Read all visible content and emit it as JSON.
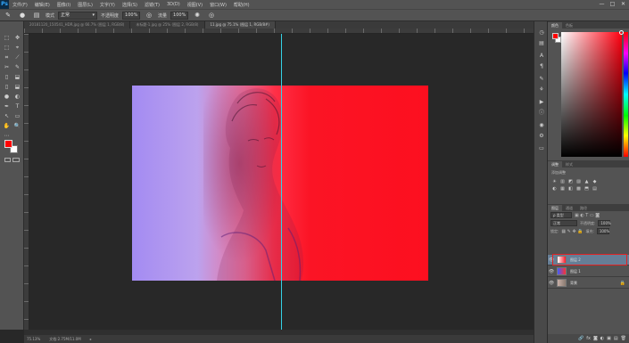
{
  "app": {
    "logo": "Ps",
    "menus": [
      "文件(F)",
      "编辑(E)",
      "图像(I)",
      "图层(L)",
      "文字(Y)",
      "选择(S)",
      "滤镜(T)",
      "3D(D)",
      "视图(V)",
      "窗口(W)",
      "帮助(H)"
    ],
    "window_controls": [
      "—",
      "□",
      "✕"
    ]
  },
  "options": {
    "mode_label": "模式",
    "mode_value": "正常",
    "opacity_label": "不透明度",
    "opacity_value": "100%",
    "flow_label": "流量",
    "flow_value": "100%"
  },
  "tabs": [
    {
      "label": "20181120_150541_HDR.jpg @ 66.7% (图层 1, RGB/8)",
      "active": false
    },
    {
      "label": "未标题-1.jpg @ 25% (图层 2, RGB/8)",
      "active": false
    },
    {
      "label": "11.jpg @ 75.1% (图层 1, RGB/8#)",
      "active": true
    }
  ],
  "tools": [
    "⬚",
    "⬚",
    "✥",
    "⌖",
    "⟋",
    "⌗",
    "✂",
    "✎",
    "▯",
    "⬓",
    "✒",
    "✐",
    "●",
    "◐",
    "T",
    "↖",
    "▭",
    "✋",
    "🔍",
    "⋯"
  ],
  "status": {
    "zoom": "75.13%",
    "doc": "文档:2.75M/11.0M"
  },
  "color_panel": {
    "tabs": [
      "颜色",
      "色板"
    ]
  },
  "adjust_panel": {
    "tabs": [
      "调整",
      "样式"
    ],
    "label": "添加调整",
    "icons": [
      "☀",
      "▥",
      "◩",
      "▨",
      "▲",
      "◆",
      "◐",
      "▦",
      "◧",
      "▩",
      "⬒",
      "▤"
    ]
  },
  "layers_panel": {
    "tabs": [
      "图层",
      "通道",
      "路径"
    ],
    "kind": "ρ 类型",
    "blend": "正常",
    "opacity_label": "不透明度:",
    "opacity_value": "100%",
    "lock_label": "锁定:",
    "fill_label": "填充:",
    "fill_value": "100%",
    "layers": [
      {
        "name": "图层 2",
        "selected": true,
        "thumb_colors": [
          "#ff1a2a",
          "#ffffff"
        ]
      },
      {
        "name": "图层 1",
        "selected": false,
        "thumb_colors": [
          "#3e5cff",
          "#ff3030"
        ]
      },
      {
        "name": "背景",
        "selected": false,
        "thumb_colors": [
          "#c8b0a8",
          "#8a7a70"
        ]
      }
    ],
    "footer_icons": [
      "🔗",
      "fx",
      "◙",
      "◐",
      "▣",
      "▤",
      "🗑"
    ]
  },
  "colors": {
    "foreground": "#ff0000",
    "background": "#ffffff",
    "guide": "#34d3e6",
    "layer_highlight": "#e02222"
  }
}
